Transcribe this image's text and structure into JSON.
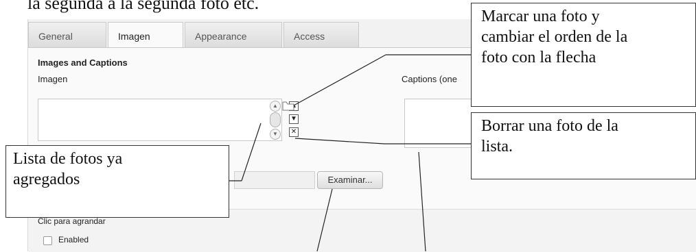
{
  "page": {
    "heading_fragment": "la segunda a la segunda foto etc."
  },
  "tabs": [
    {
      "label": "General",
      "active": false
    },
    {
      "label": "Imagen",
      "active": true
    },
    {
      "label": "Appearance",
      "active": false
    },
    {
      "label": "Access",
      "active": false
    }
  ],
  "section": {
    "title": "Images and Captions",
    "image_label": "Imagen",
    "captions_label": "Captions (one"
  },
  "controls": {
    "browse_label": "Examinar...",
    "enlarge_label": "Clic para agrandar",
    "enabled_label": "Enabled",
    "enabled_checked": false
  },
  "icons": {
    "move_up": "arrow-up-icon",
    "move_down": "arrow-down-icon",
    "remove": "close-icon",
    "folder": "folder-icon"
  },
  "callouts": {
    "reorder": [
      "Marcar una foto y",
      "cambiar el orden de la",
      "foto con la flecha"
    ],
    "delete": [
      "Borrar una foto de la",
      "lista."
    ],
    "list": [
      "Lista de fotos ya",
      "agregados"
    ]
  }
}
